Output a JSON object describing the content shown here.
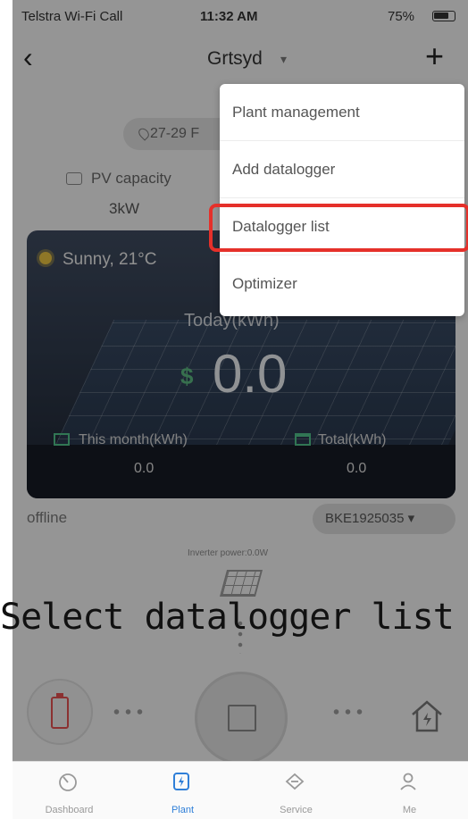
{
  "status_bar": {
    "carrier": "Telstra Wi-Fi Call",
    "time": "11:32 AM",
    "battery": "75%"
  },
  "nav": {
    "back_icon": "chevron-left-icon",
    "title": "Grtsyd",
    "add_icon": "plus-icon"
  },
  "plant": {
    "address": "27-29 F",
    "pv_capacity_label": "PV capacity",
    "pv_capacity_value": "3kW",
    "weather": "Sunny, 21°C",
    "today_label": "Today(kWh)",
    "today_value": "0.0",
    "month_label": "This month(kWh)",
    "month_value": "0.0",
    "total_label": "Total(kWh)",
    "total_value": "0.0",
    "status": "offline",
    "serial": "BKE1925035",
    "inverter_power": "Inverter power:0.0W"
  },
  "menu": {
    "items": [
      {
        "label": "Plant management"
      },
      {
        "label": "Add datalogger"
      },
      {
        "label": "Datalogger list"
      },
      {
        "label": "Optimizer"
      }
    ],
    "highlight_color": "#e5302a"
  },
  "tabbar": {
    "tabs": [
      {
        "label": "Dashboard",
        "icon": "dashboard-icon"
      },
      {
        "label": "Plant",
        "icon": "plant-icon"
      },
      {
        "label": "Service",
        "icon": "service-icon"
      },
      {
        "label": "Me",
        "icon": "me-icon"
      }
    ],
    "active_color": "#2f7fd8"
  },
  "caption": "Select datalogger list"
}
